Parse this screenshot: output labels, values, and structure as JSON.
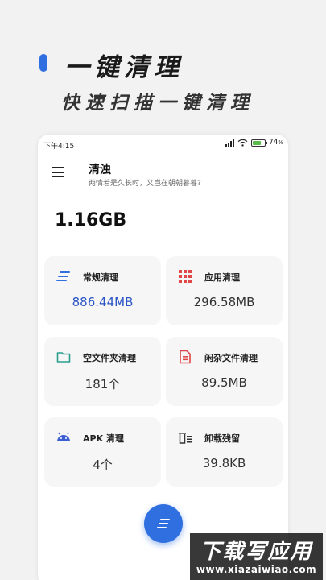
{
  "promo": {
    "title": "一键清理",
    "subtitle": "快速扫描一键清理",
    "accent_color": "#2f6fe0"
  },
  "status_bar": {
    "time": "下午4:15",
    "battery_percent": "74",
    "battery_suffix": "%",
    "battery_level": 0.74,
    "icons": [
      "signal-icon",
      "wifi-icon",
      "battery-icon"
    ]
  },
  "app": {
    "title": "清浊",
    "subtitle": "两情若是久长时，又岂在朝朝暮暮?",
    "menu_icon": "hamburger-menu-icon",
    "total_size": "1.16GB"
  },
  "cards": [
    {
      "id": "regular",
      "icon": "lines-icon",
      "label": "常规清理",
      "value": "886.44MB",
      "icon_color": "#2f6fe0",
      "value_color": "#2a55c4"
    },
    {
      "id": "app",
      "icon": "grid-icon",
      "label": "应用清理",
      "value": "296.58MB",
      "icon_color": "#e04848"
    },
    {
      "id": "empty-folder",
      "icon": "folder-icon",
      "label": "空文件夹清理",
      "value": "181个",
      "icon_color": "#2a9d8f"
    },
    {
      "id": "misc-file",
      "icon": "document-icon",
      "label": "闲杂文件清理",
      "value": "89.5MB",
      "icon_color": "#e04848"
    },
    {
      "id": "apk",
      "icon": "android-icon",
      "label": "APK 清理",
      "value": "4个",
      "icon_color": "#3b5fd0"
    },
    {
      "id": "uninstall-residue",
      "icon": "trash-list-icon",
      "label": "卸载残留",
      "value": "39.8KB",
      "icon_color": "#333333"
    }
  ],
  "fab": {
    "icon": "lines-icon",
    "color": "#2f6fe0"
  },
  "watermark": {
    "main": "下载写应用",
    "url": "www.xiazaiwiao.com"
  }
}
